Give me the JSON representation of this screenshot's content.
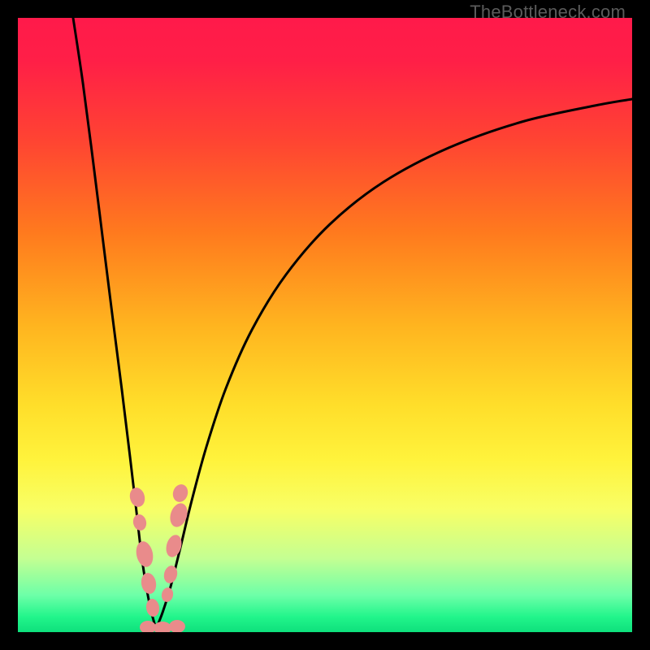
{
  "watermark": "TheBottleneck.com",
  "gradient_stops": [
    {
      "offset": 0.0,
      "color": "#ff1a4a"
    },
    {
      "offset": 0.07,
      "color": "#ff1f47"
    },
    {
      "offset": 0.2,
      "color": "#ff4432"
    },
    {
      "offset": 0.35,
      "color": "#ff7a1e"
    },
    {
      "offset": 0.5,
      "color": "#ffb41f"
    },
    {
      "offset": 0.63,
      "color": "#ffde2a"
    },
    {
      "offset": 0.72,
      "color": "#fff33c"
    },
    {
      "offset": 0.8,
      "color": "#f8ff66"
    },
    {
      "offset": 0.88,
      "color": "#c4ff92"
    },
    {
      "offset": 0.94,
      "color": "#6dffa8"
    },
    {
      "offset": 0.975,
      "color": "#22f58b"
    },
    {
      "offset": 1.0,
      "color": "#0ee07c"
    }
  ],
  "chart_data": {
    "type": "line",
    "title": "",
    "xlabel": "",
    "ylabel": "",
    "x_range": [
      0,
      756
    ],
    "y_range_percent": [
      0,
      100
    ],
    "minimum_x": 170,
    "series": [
      {
        "name": "left-branch",
        "points": [
          {
            "x": 68,
            "y": 0
          },
          {
            "x": 80,
            "y": 80
          },
          {
            "x": 92,
            "y": 172
          },
          {
            "x": 104,
            "y": 268
          },
          {
            "x": 116,
            "y": 364
          },
          {
            "x": 128,
            "y": 458
          },
          {
            "x": 138,
            "y": 540
          },
          {
            "x": 146,
            "y": 608
          },
          {
            "x": 152,
            "y": 660
          },
          {
            "x": 158,
            "y": 700
          },
          {
            "x": 164,
            "y": 730
          },
          {
            "x": 170,
            "y": 752
          }
        ]
      },
      {
        "name": "right-branch",
        "points": [
          {
            "x": 170,
            "y": 752
          },
          {
            "x": 178,
            "y": 732
          },
          {
            "x": 188,
            "y": 700
          },
          {
            "x": 200,
            "y": 652
          },
          {
            "x": 214,
            "y": 594
          },
          {
            "x": 232,
            "y": 528
          },
          {
            "x": 256,
            "y": 456
          },
          {
            "x": 288,
            "y": 384
          },
          {
            "x": 330,
            "y": 316
          },
          {
            "x": 384,
            "y": 254
          },
          {
            "x": 450,
            "y": 202
          },
          {
            "x": 530,
            "y": 160
          },
          {
            "x": 620,
            "y": 128
          },
          {
            "x": 710,
            "y": 108
          },
          {
            "x": 756,
            "y": 100
          }
        ]
      }
    ],
    "marker_clusters": [
      {
        "name": "left-cluster",
        "color": "#e98b8b",
        "markers": [
          {
            "cx": 147,
            "cy": 590,
            "rx": 9,
            "ry": 12,
            "rot": -14
          },
          {
            "cx": 150,
            "cy": 621,
            "rx": 8,
            "ry": 10,
            "rot": -14
          },
          {
            "cx": 156,
            "cy": 660,
            "rx": 10,
            "ry": 16,
            "rot": -12
          },
          {
            "cx": 161,
            "cy": 696,
            "rx": 9,
            "ry": 13,
            "rot": -10
          },
          {
            "cx": 166,
            "cy": 726,
            "rx": 8,
            "ry": 11,
            "rot": -8
          }
        ]
      },
      {
        "name": "right-cluster",
        "color": "#e98b8b",
        "markers": [
          {
            "cx": 200,
            "cy": 585,
            "rx": 9,
            "ry": 11,
            "rot": 18
          },
          {
            "cx": 198,
            "cy": 612,
            "rx": 10,
            "ry": 15,
            "rot": 18
          },
          {
            "cx": 192,
            "cy": 650,
            "rx": 9,
            "ry": 14,
            "rot": 16
          },
          {
            "cx": 188,
            "cy": 685,
            "rx": 8,
            "ry": 11,
            "rot": 14
          },
          {
            "cx": 184,
            "cy": 710,
            "rx": 7,
            "ry": 9,
            "rot": 12
          }
        ]
      },
      {
        "name": "bottom-cluster",
        "color": "#e98b8b",
        "markers": [
          {
            "cx": 160,
            "cy": 750,
            "rx": 10,
            "ry": 8,
            "rot": 0
          },
          {
            "cx": 178,
            "cy": 751,
            "rx": 11,
            "ry": 8,
            "rot": 0
          },
          {
            "cx": 196,
            "cy": 749,
            "rx": 10,
            "ry": 8,
            "rot": 0
          }
        ]
      }
    ]
  }
}
